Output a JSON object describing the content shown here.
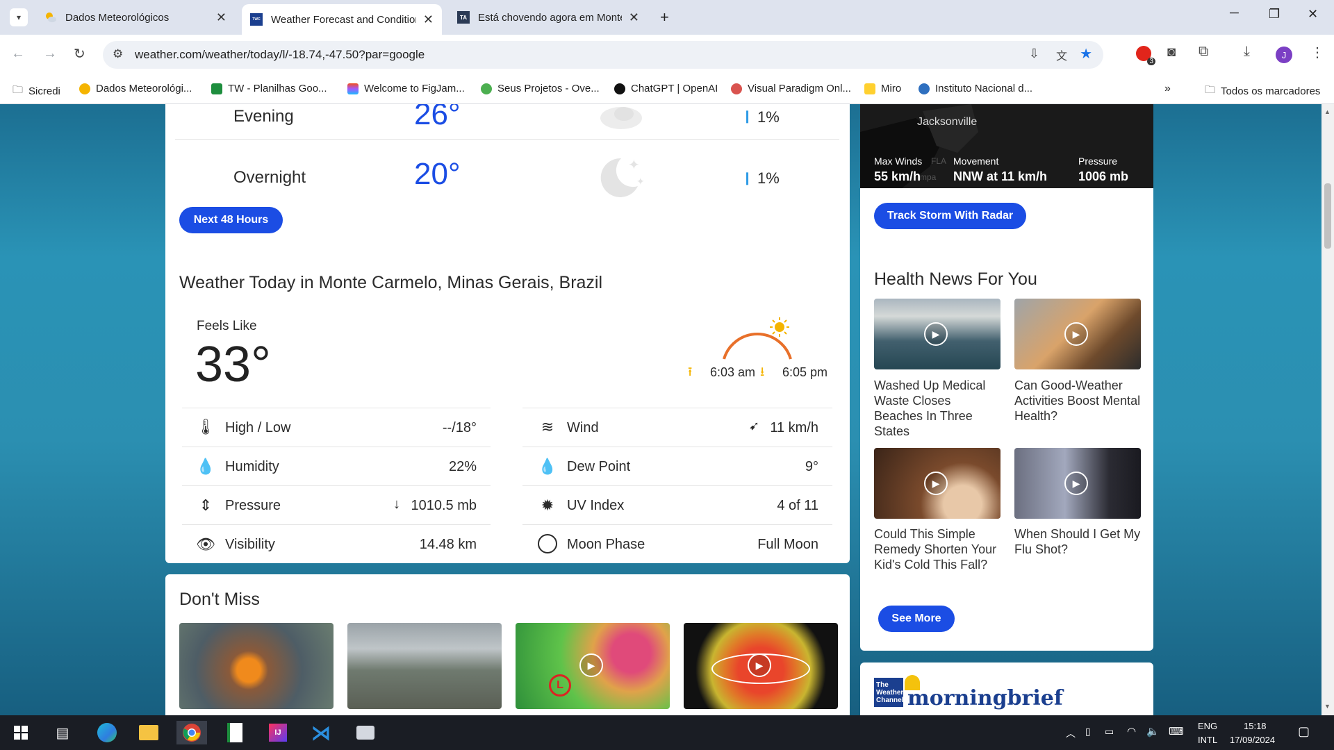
{
  "tabs": [
    {
      "title": "Dados Meteorológicos"
    },
    {
      "title": "Weather Forecast and Conditions"
    },
    {
      "title": "Está chovendo agora em Monte Carmelo"
    }
  ],
  "url": "weather.com/weather/today/l/-18.74,-47.50?par=google",
  "bookmarks": [
    "Sicredi",
    "Dados Meteorológi...",
    "TW - Planilhas Goo...",
    "Welcome to FigJam...",
    "Seus Projetos - Ove...",
    "ChatGPT | OpenAI",
    "Visual Paradigm Onl...",
    "Miro",
    "Instituto Nacional d..."
  ],
  "bookmarks_all": "Todos os marcadores",
  "hourly": [
    {
      "name": "Evening",
      "temp": "26°",
      "precip": "1%"
    },
    {
      "name": "Overnight",
      "temp": "20°",
      "precip": "1%"
    }
  ],
  "next48_label": "Next 48 Hours",
  "storm": {
    "map_label": "Jacksonville",
    "map_faint": "FLA",
    "map_faint2": "mpa",
    "max_winds_label": "Max Winds",
    "max_winds": "55 km/h",
    "movement_label": "Movement",
    "movement": "NNW at 11 km/h",
    "pressure_label": "Pressure",
    "pressure": "1006 mb",
    "button": "Track Storm With Radar"
  },
  "today": {
    "title": "Weather Today in Monte Carmelo, Minas Gerais, Brazil",
    "feels_like_label": "Feels Like",
    "feels_like": "33°",
    "sunrise": "6:03 am",
    "sunset": "6:05 pm",
    "details": [
      {
        "label": "High / Low",
        "value": "--/18°",
        "icon": "thermometer-icon"
      },
      {
        "label": "Wind",
        "value": "11 km/h",
        "icon": "wind-icon"
      },
      {
        "label": "Humidity",
        "value": "22%",
        "icon": "humidity-icon"
      },
      {
        "label": "Dew Point",
        "value": "9°",
        "icon": "dew-point-icon"
      },
      {
        "label": "Pressure",
        "value": "1010.5 mb",
        "icon": "pressure-icon"
      },
      {
        "label": "UV Index",
        "value": "4 of 11",
        "icon": "uv-icon"
      },
      {
        "label": "Visibility",
        "value": "14.48 km",
        "icon": "eye-icon"
      },
      {
        "label": "Moon Phase",
        "value": "Full Moon",
        "icon": "moon-phase-icon"
      }
    ]
  },
  "dont_miss": {
    "title": "Don't Miss"
  },
  "health": {
    "title": "Health News For You",
    "items": [
      {
        "text": "Washed Up Medical Waste Closes Beaches In Three States"
      },
      {
        "text": "Can Good-Weather Activities Boost Mental Health?"
      },
      {
        "text": "Could This Simple Remedy Shorten Your Kid's Cold This Fall?"
      },
      {
        "text": "When Should I Get My Flu Shot?"
      }
    ],
    "see_more": "See More"
  },
  "morning": {
    "logo_line1": "The",
    "logo_line2": "Weather",
    "logo_line3": "Channel",
    "brand": "morningbrief"
  },
  "taskbar": {
    "lang1": "ENG",
    "lang2": "INTL",
    "time": "15:18",
    "date": "17/09/2024"
  },
  "profile_initial": "J",
  "ext_badge": "3",
  "colors": {
    "accent": "#1b4de4",
    "temp": "#1b4de4",
    "precip": "#2e9be6",
    "sun_arc": "#e8702a"
  }
}
